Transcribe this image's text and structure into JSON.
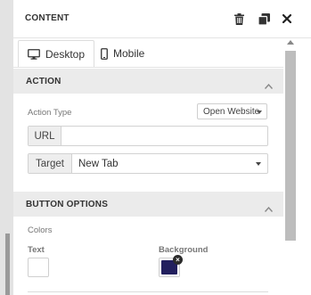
{
  "panel": {
    "title": "CONTENT",
    "icons": {
      "delete": "trash-icon",
      "duplicate": "duplicate-icon",
      "close": "close-icon"
    }
  },
  "tabs": [
    {
      "label": "Desktop",
      "icon": "desktop-icon",
      "active": true
    },
    {
      "label": "Mobile",
      "icon": "mobile-icon",
      "active": false
    }
  ],
  "action": {
    "section_title": "ACTION",
    "type_label": "Action Type",
    "type_value": "Open Website",
    "url_addon": "URL",
    "url_value": "",
    "target_addon": "Target",
    "target_value": "New Tab"
  },
  "button_options": {
    "section_title": "BUTTON OPTIONS",
    "colors_label": "Colors",
    "text_label": "Text",
    "background_label": "Background",
    "background_color": "#22205e",
    "clear_glyph": "×"
  },
  "colors": {
    "section_bg": "#ebebeb",
    "accent_dark": "#22205e"
  }
}
